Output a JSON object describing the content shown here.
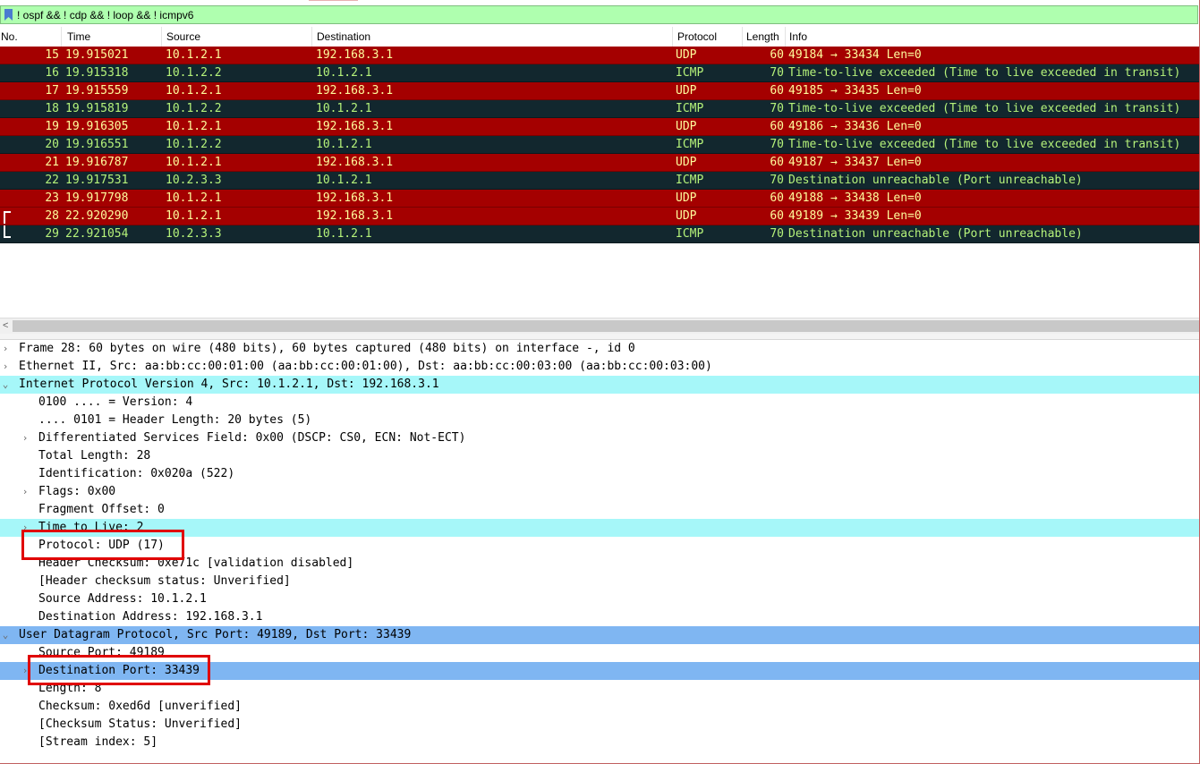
{
  "filter": {
    "text": "! ospf && ! cdp && ! loop && ! icmpv6",
    "icon": "bookmark-icon"
  },
  "columns": {
    "no": "No.",
    "time": "Time",
    "source": "Source",
    "destination": "Destination",
    "protocol": "Protocol",
    "length": "Length",
    "info": "Info"
  },
  "packets": [
    {
      "no": "15",
      "time": "19.915021",
      "src": "10.1.2.1",
      "dst": "192.168.3.1",
      "proto": "UDP",
      "len": "60",
      "info": "49184 → 33434 Len=0"
    },
    {
      "no": "16",
      "time": "19.915318",
      "src": "10.1.2.2",
      "dst": "10.1.2.1",
      "proto": "ICMP",
      "len": "70",
      "info": "Time-to-live exceeded (Time to live exceeded in transit)"
    },
    {
      "no": "17",
      "time": "19.915559",
      "src": "10.1.2.1",
      "dst": "192.168.3.1",
      "proto": "UDP",
      "len": "60",
      "info": "49185 → 33435 Len=0"
    },
    {
      "no": "18",
      "time": "19.915819",
      "src": "10.1.2.2",
      "dst": "10.1.2.1",
      "proto": "ICMP",
      "len": "70",
      "info": "Time-to-live exceeded (Time to live exceeded in transit)"
    },
    {
      "no": "19",
      "time": "19.916305",
      "src": "10.1.2.1",
      "dst": "192.168.3.1",
      "proto": "UDP",
      "len": "60",
      "info": "49186 → 33436 Len=0"
    },
    {
      "no": "20",
      "time": "19.916551",
      "src": "10.1.2.2",
      "dst": "10.1.2.1",
      "proto": "ICMP",
      "len": "70",
      "info": "Time-to-live exceeded (Time to live exceeded in transit)"
    },
    {
      "no": "21",
      "time": "19.916787",
      "src": "10.1.2.1",
      "dst": "192.168.3.1",
      "proto": "UDP",
      "len": "60",
      "info": "49187 → 33437 Len=0"
    },
    {
      "no": "22",
      "time": "19.917531",
      "src": "10.2.3.3",
      "dst": "10.1.2.1",
      "proto": "ICMP",
      "len": "70",
      "info": "Destination unreachable (Port unreachable)"
    },
    {
      "no": "23",
      "time": "19.917798",
      "src": "10.1.2.1",
      "dst": "192.168.3.1",
      "proto": "UDP",
      "len": "60",
      "info": "49188 → 33438 Len=0"
    },
    {
      "no": "28",
      "time": "22.920290",
      "src": "10.1.2.1",
      "dst": "192.168.3.1",
      "proto": "UDP",
      "len": "60",
      "info": "49189 → 33439 Len=0"
    },
    {
      "no": "29",
      "time": "22.921054",
      "src": "10.2.3.3",
      "dst": "10.1.2.1",
      "proto": "ICMP",
      "len": "70",
      "info": "Destination unreachable (Port unreachable)"
    }
  ],
  "details": [
    {
      "text": "Frame 28: 60 bytes on wire (480 bits), 60 bytes captured (480 bits) on interface -, id 0",
      "expander": "›"
    },
    {
      "text": "Ethernet II, Src: aa:bb:cc:00:01:00 (aa:bb:cc:00:01:00), Dst: aa:bb:cc:00:03:00 (aa:bb:cc:00:03:00)",
      "expander": "›"
    },
    {
      "text": "Internet Protocol Version 4, Src: 10.1.2.1, Dst: 192.168.3.1",
      "expander": "⌄"
    },
    {
      "text": "0100 .... = Version: 4",
      "expander": ""
    },
    {
      "text": ".... 0101 = Header Length: 20 bytes (5)",
      "expander": ""
    },
    {
      "text": "Differentiated Services Field: 0x00 (DSCP: CS0, ECN: Not-ECT)",
      "expander": "›"
    },
    {
      "text": "Total Length: 28",
      "expander": ""
    },
    {
      "text": "Identification: 0x020a (522)",
      "expander": ""
    },
    {
      "text": "Flags: 0x00",
      "expander": "›"
    },
    {
      "text": "Fragment Offset: 0",
      "expander": ""
    },
    {
      "text": "Time to Live: 2",
      "expander": "›"
    },
    {
      "text": "Protocol: UDP (17)",
      "expander": ""
    },
    {
      "text": "Header Checksum: 0xe71c [validation disabled]",
      "expander": ""
    },
    {
      "text": "[Header checksum status: Unverified]",
      "expander": ""
    },
    {
      "text": "Source Address: 10.1.2.1",
      "expander": ""
    },
    {
      "text": "Destination Address: 192.168.3.1",
      "expander": ""
    },
    {
      "text": "User Datagram Protocol, Src Port: 49189, Dst Port: 33439",
      "expander": "⌄"
    },
    {
      "text": "Source Port: 49189",
      "expander": ""
    },
    {
      "text": "Destination Port: 33439",
      "expander": "›"
    },
    {
      "text": "Length: 8",
      "expander": ""
    },
    {
      "text": "Checksum: 0xed6d [unverified]",
      "expander": ""
    },
    {
      "text": "[Checksum Status: Unverified]",
      "expander": ""
    },
    {
      "text": "[Stream index: 5]",
      "expander": ""
    }
  ],
  "colors": {
    "udp_row_bg": "#a40000",
    "udp_row_fg": "#fffc9c",
    "icmp_row_bg": "#12272e",
    "icmp_row_fg": "#b5f27a",
    "ip_highlight": "#a6f7f9",
    "udp_highlight": "#7fb6f2",
    "filter_bg": "#afffaf",
    "annotation_box": "#e00000"
  }
}
